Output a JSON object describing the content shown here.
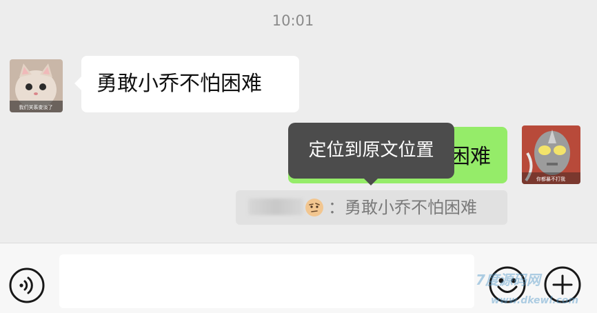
{
  "chat": {
    "timestamp": "10:01",
    "incoming_message": "勇敢小乔不怕困难",
    "outgoing_message_visible": "困难",
    "quote": {
      "text": "：勇敢小乔不怕困难"
    },
    "avatar_left_caption": "我们关系变淡了",
    "avatar_right_caption": "你都暴不打我"
  },
  "context_menu": {
    "locate_label": "定位到原文位置"
  },
  "input_bar": {
    "text_value": "",
    "voice_icon": "voice-icon",
    "emoji_icon": "emoji-icon",
    "plus_icon": "plus-icon"
  },
  "watermark": {
    "brand": "7度源码网",
    "url": "www.dkewl.com"
  },
  "colors": {
    "background": "#ededed",
    "outgoing_bubble": "#95ec69",
    "incoming_bubble": "#ffffff",
    "tooltip": "#4c4c4c",
    "quote_bg": "#e1e1e1"
  }
}
